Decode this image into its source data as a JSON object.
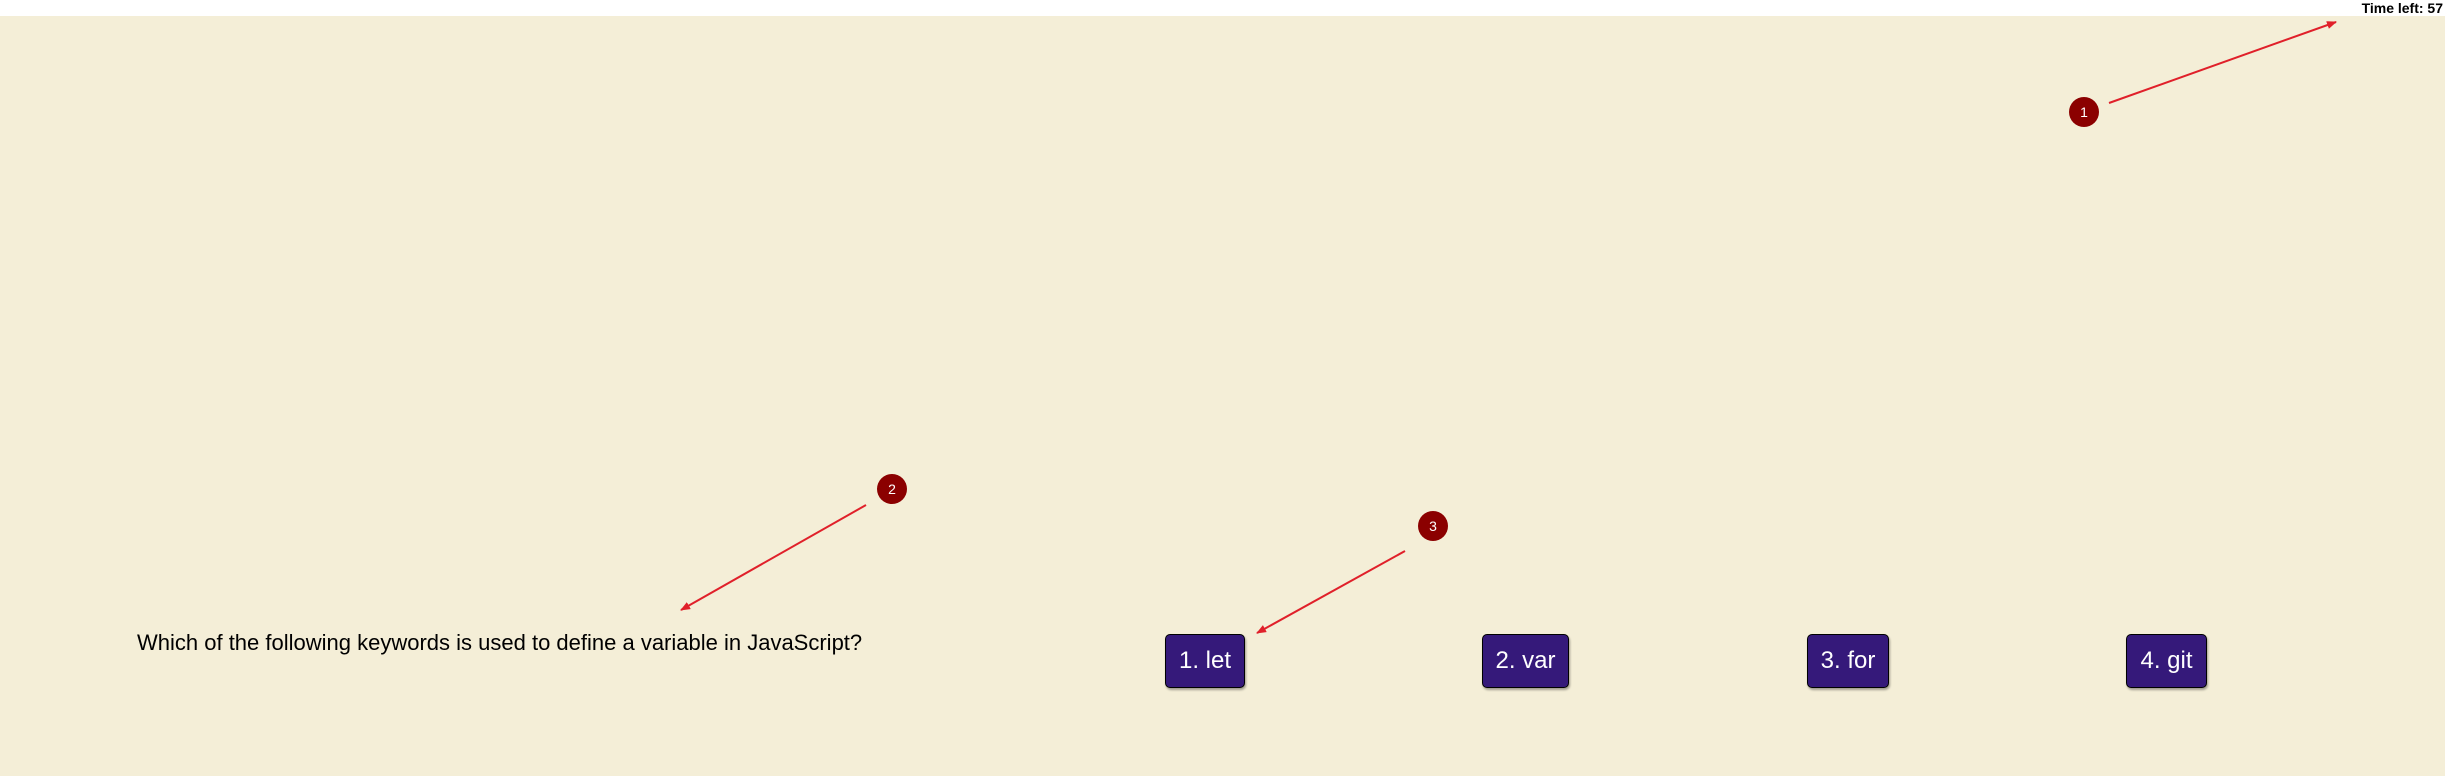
{
  "timer": {
    "label": "Time left: 57",
    "seconds": 57
  },
  "question": {
    "text": "Which of the following keywords is used to define a variable in JavaScript?"
  },
  "answers": [
    {
      "label": "1. let"
    },
    {
      "label": "2. var"
    },
    {
      "label": "3. for"
    },
    {
      "label": "4. git"
    }
  ],
  "annotations": {
    "markers": [
      "1",
      "2",
      "3"
    ],
    "marker_color": "#8b0000",
    "arrow_color": "#e0202a"
  },
  "colors": {
    "background": "#f4eed7",
    "button": "#35197a",
    "button_text": "#ffffff"
  }
}
